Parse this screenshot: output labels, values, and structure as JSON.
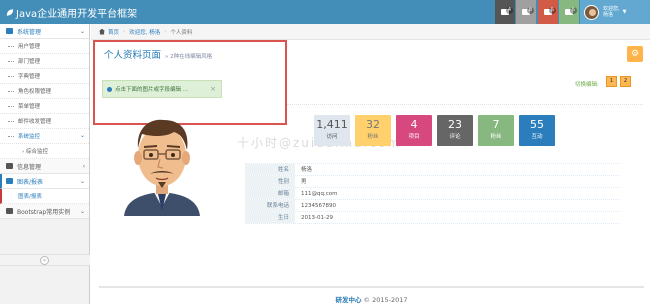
{
  "navbar": {
    "brand": "Java企业通用开发平台框架",
    "badges": [
      {
        "name": "tasks",
        "count": "4",
        "color": "#555555"
      },
      {
        "name": "notifications",
        "count": "8",
        "color": "#a0a0a0"
      },
      {
        "name": "messages",
        "count": "5",
        "color": "#d15b47"
      },
      {
        "name": "mail",
        "count": "5",
        "color": "#87b87f"
      }
    ],
    "user_greeting": "欢迎您,",
    "user_name": "杨洛"
  },
  "sidebar": {
    "items": [
      {
        "label": "系统管理",
        "icon": "desktop-icon",
        "arrow": "⌄",
        "type": "open"
      },
      {
        "label": "用户管理",
        "type": "sub"
      },
      {
        "label": "部门管理",
        "type": "sub"
      },
      {
        "label": "字典管理",
        "type": "sub"
      },
      {
        "label": "角色权限管理",
        "type": "sub"
      },
      {
        "label": "菜单管理",
        "type": "sub"
      },
      {
        "label": "邮件收发管理",
        "type": "sub"
      },
      {
        "label": "系统监控",
        "arrow": "⌄",
        "type": "sub-active"
      },
      {
        "label": "› 综合监控",
        "type": "sub2"
      },
      {
        "label": "信息管理",
        "icon": "list-icon",
        "arrow": "‹",
        "type": "menu"
      },
      {
        "label": "图表/报表",
        "icon": "chart-icon",
        "arrow": "⌄",
        "type": "active-parent"
      },
      {
        "label": "图表/报表",
        "type": "highlight"
      },
      {
        "label": "Bootstrap常用实例",
        "icon": "bootstrap-icon",
        "arrow": "⌄",
        "type": "menu"
      }
    ],
    "collapse_symbol": "«"
  },
  "breadcrumb": {
    "home": "首页",
    "middle": "欢迎您, 杨洛",
    "current": "个人资料"
  },
  "page": {
    "title": "个人资料页面",
    "subtitle": "» 2种在线编辑风格",
    "alert_text": "点击下面的图片或字段编辑 ...",
    "alert_close": "×",
    "switch_label": "切换编辑:",
    "switch_options": [
      "1",
      "2"
    ]
  },
  "stats": [
    {
      "value": "1,411",
      "label": "访问",
      "color": "#dfe6ee",
      "text_color": "#555555"
    },
    {
      "value": "32",
      "label": "粉丝",
      "color": "#ffd06b",
      "text_color": "#777777"
    },
    {
      "value": "4",
      "label": "项目",
      "color": "#d6487e",
      "text_color": "#ffffff"
    },
    {
      "value": "23",
      "label": "评论",
      "color": "#666666",
      "text_color": "#ffffff"
    },
    {
      "value": "7",
      "label": "粉丝",
      "color": "#87b87f",
      "text_color": "#ffffff"
    },
    {
      "value": "55",
      "label": "互动",
      "color": "#2b7dbc",
      "text_color": "#ffffff"
    }
  ],
  "profile": {
    "rows": [
      {
        "key": "姓名",
        "value": "杨洛"
      },
      {
        "key": "性别",
        "value": "男"
      },
      {
        "key": "邮箱",
        "value": "111@qq.com"
      },
      {
        "key": "联系电话",
        "value": "1234567890"
      },
      {
        "key": "生日",
        "value": "2013-01-29"
      }
    ]
  },
  "watermark": "十小时@zuidaima.com",
  "footer": {
    "brand": "研发中心",
    "copyright": " © 2015-2017"
  }
}
